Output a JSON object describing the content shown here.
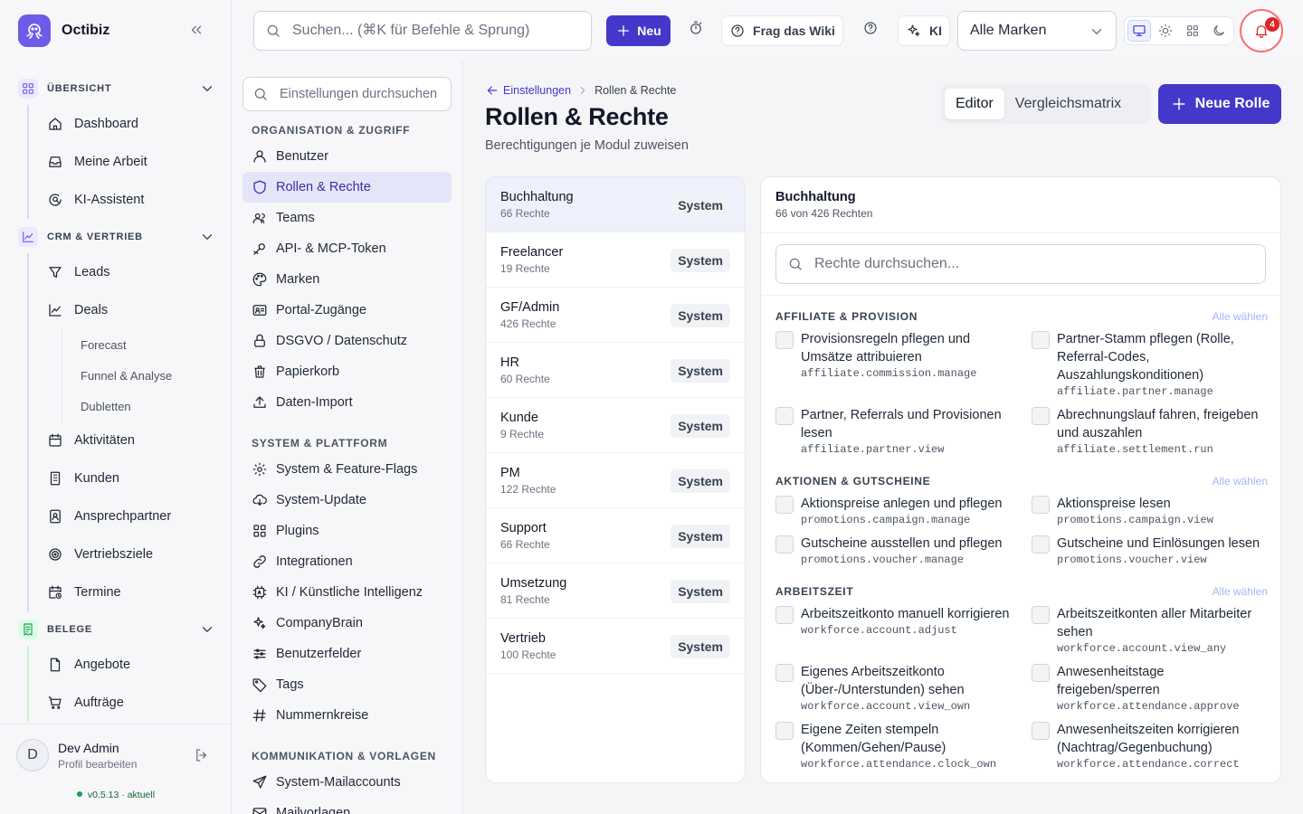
{
  "app": {
    "name": "Octibiz"
  },
  "sidebar": {
    "sections": [
      {
        "label": "ÜBERSICHT",
        "icon": "grid-icon",
        "color": "#6d5ce8",
        "items": [
          {
            "label": "Dashboard",
            "icon": "home-icon"
          },
          {
            "label": "Meine Arbeit",
            "icon": "inbox-icon"
          },
          {
            "label": "KI-Assistent",
            "icon": "chat-search-icon"
          }
        ]
      },
      {
        "label": "CRM & VERTRIEB",
        "icon": "chart-icon",
        "color": "#6d5ce8",
        "items": [
          {
            "label": "Leads",
            "icon": "funnel-icon"
          },
          {
            "label": "Deals",
            "icon": "trend-icon"
          }
        ],
        "subitems": [
          {
            "label": "Forecast"
          },
          {
            "label": "Funnel & Analyse"
          },
          {
            "label": "Dubletten"
          }
        ],
        "items2": [
          {
            "label": "Aktivitäten",
            "icon": "calendar-icon"
          },
          {
            "label": "Kunden",
            "icon": "building-icon"
          },
          {
            "label": "Ansprechpartner",
            "icon": "contact-icon"
          },
          {
            "label": "Vertriebsziele",
            "icon": "target-icon"
          },
          {
            "label": "Termine",
            "icon": "calendar-clock-icon"
          }
        ]
      },
      {
        "label": "BELEGE",
        "icon": "receipt-icon",
        "color": "#16a34a",
        "items": [
          {
            "label": "Angebote",
            "icon": "file-icon"
          },
          {
            "label": "Aufträge",
            "icon": "cart-icon"
          }
        ]
      }
    ],
    "user": {
      "name": "Dev Admin",
      "sub": "Profil bearbeiten",
      "initial": "D"
    },
    "version": "v0.5.13 · aktuell"
  },
  "topbar": {
    "search_placeholder": "Suchen... (⌘K für Befehle & Sprung)",
    "new_label": "Neu",
    "wiki_label": "Frag das Wiki",
    "ai_label": "KI",
    "brand_select": "Alle Marken",
    "notifications": "4"
  },
  "settings": {
    "search_placeholder": "Einstellungen durchsuchen",
    "groups": [
      {
        "label": "ORGANISATION & ZUGRIFF",
        "items": [
          {
            "label": "Benutzer",
            "icon": "user-icon"
          },
          {
            "label": "Rollen & Rechte",
            "icon": "shield-icon",
            "active": true
          },
          {
            "label": "Teams",
            "icon": "users-icon"
          },
          {
            "label": "API- & MCP-Token",
            "icon": "key-icon"
          },
          {
            "label": "Marken",
            "icon": "palette-icon"
          },
          {
            "label": "Portal-Zugänge",
            "icon": "id-card-icon"
          },
          {
            "label": "DSGVO / Datenschutz",
            "icon": "lock-icon"
          },
          {
            "label": "Papierkorb",
            "icon": "trash-icon"
          },
          {
            "label": "Daten-Import",
            "icon": "upload-icon"
          }
        ]
      },
      {
        "label": "SYSTEM & PLATTFORM",
        "items": [
          {
            "label": "System & Feature-Flags",
            "icon": "gear-icon"
          },
          {
            "label": "System-Update",
            "icon": "cloud-download-icon"
          },
          {
            "label": "Plugins",
            "icon": "grid-icon"
          },
          {
            "label": "Integrationen",
            "icon": "link-icon"
          },
          {
            "label": "KI / Künstliche Intelligenz",
            "icon": "chip-icon"
          },
          {
            "label": "CompanyBrain",
            "icon": "sparkle-icon"
          },
          {
            "label": "Benutzerfelder",
            "icon": "sliders-icon"
          },
          {
            "label": "Tags",
            "icon": "tag-icon"
          },
          {
            "label": "Nummernkreise",
            "icon": "hash-icon"
          }
        ]
      },
      {
        "label": "KOMMUNIKATION & VORLAGEN",
        "items": [
          {
            "label": "System-Mailaccounts",
            "icon": "send-icon"
          },
          {
            "label": "Mailvorlagen",
            "icon": "mail-icon"
          }
        ]
      }
    ]
  },
  "page": {
    "breadcrumb_parent": "Einstellungen",
    "breadcrumb_current": "Rollen & Rechte",
    "title": "Rollen & Rechte",
    "subtitle": "Berechtigungen je Modul zuweisen",
    "tabs": [
      "Editor",
      "Vergleichsmatrix"
    ],
    "new_role": "Neue Rolle"
  },
  "roles": [
    {
      "name": "Buchhaltung",
      "count": "66 Rechte",
      "tag": "System",
      "active": true
    },
    {
      "name": "Freelancer",
      "count": "19 Rechte",
      "tag": "System"
    },
    {
      "name": "GF/Admin",
      "count": "426 Rechte",
      "tag": "System"
    },
    {
      "name": "HR",
      "count": "60 Rechte",
      "tag": "System"
    },
    {
      "name": "Kunde",
      "count": "9 Rechte",
      "tag": "System"
    },
    {
      "name": "PM",
      "count": "122 Rechte",
      "tag": "System"
    },
    {
      "name": "Support",
      "count": "66 Rechte",
      "tag": "System"
    },
    {
      "name": "Umsetzung",
      "count": "81 Rechte",
      "tag": "System"
    },
    {
      "name": "Vertrieb",
      "count": "100 Rechte",
      "tag": "System"
    }
  ],
  "permissions": {
    "title": "Buchhaltung",
    "subtitle": "66 von 426 Rechten",
    "search_placeholder": "Rechte durchsuchen...",
    "select_all": "Alle wählen",
    "categories": [
      {
        "label": "AFFILIATE & PROVISION",
        "items": [
          {
            "label": "Provisionsregeln pflegen und Umsätze attribuieren",
            "key": "affiliate.commission.manage"
          },
          {
            "label": "Partner-Stamm pflegen (Rolle, Referral-Codes, Auszahlungskonditionen)",
            "key": "affiliate.partner.manage"
          },
          {
            "label": "Partner, Referrals und Provisionen lesen",
            "key": "affiliate.partner.view"
          },
          {
            "label": "Abrechnungslauf fahren, freigeben und auszahlen",
            "key": "affiliate.settlement.run"
          }
        ]
      },
      {
        "label": "AKTIONEN & GUTSCHEINE",
        "items": [
          {
            "label": "Aktionspreise anlegen und pflegen",
            "key": "promotions.campaign.manage"
          },
          {
            "label": "Aktionspreise lesen",
            "key": "promotions.campaign.view"
          },
          {
            "label": "Gutscheine ausstellen und pflegen",
            "key": "promotions.voucher.manage"
          },
          {
            "label": "Gutscheine und Einlösungen lesen",
            "key": "promotions.voucher.view"
          }
        ]
      },
      {
        "label": "ARBEITSZEIT",
        "items": [
          {
            "label": "Arbeitszeitkonto manuell korrigieren",
            "key": "workforce.account.adjust"
          },
          {
            "label": "Arbeitszeitkonten aller Mitarbeiter sehen",
            "key": "workforce.account.view_any"
          },
          {
            "label": "Eigenes Arbeitszeitkonto (Über-/Unterstunden) sehen",
            "key": "workforce.account.view_own"
          },
          {
            "label": "Anwesenheitstage freigeben/sperren",
            "key": "workforce.attendance.approve"
          },
          {
            "label": "Eigene Zeiten stempeln (Kommen/Gehen/Pause)",
            "key": "workforce.attendance.clock_own"
          },
          {
            "label": "Anwesenheitszeiten korrigieren (Nachtrag/Gegenbuchung)",
            "key": "workforce.attendance.correct"
          }
        ]
      }
    ]
  }
}
